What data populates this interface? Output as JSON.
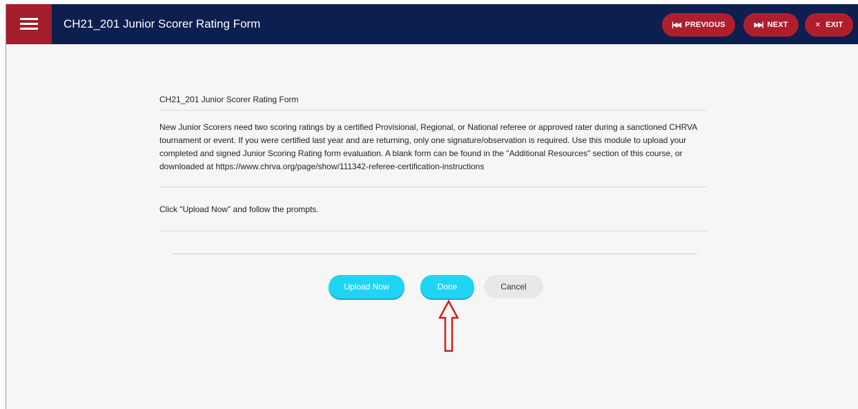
{
  "header": {
    "course_title": "CH21_201 Junior Scorer Rating Form",
    "previous_label": "PREVIOUS",
    "next_label": "NEXT",
    "exit_label": "EXIT"
  },
  "main": {
    "page_heading": "CH21_201 Junior Scorer Rating Form",
    "description": "New Junior Scorers need two scoring ratings by a certified Provisional, Regional, or National referee or approved rater during a sanctioned CHRVA tournament or event. If you were certified last year and are returning, only one signature/observation is required. Use this module to upload your completed and signed Junior Scoring Rating form evaluation. A blank form can be found in the \"Additional Resources\" section of this course, or downloaded at https://www.chrva.org/page/show/111342-referee-certification-instructions",
    "instruction": "Click \"Upload Now\" and follow the prompts."
  },
  "actions": {
    "upload_label": "Upload Now",
    "done_label": "Done",
    "cancel_label": "Cancel"
  },
  "icons": {
    "menu": "hamburger-menu-icon",
    "previous": "skip-back-icon",
    "next": "skip-forward-icon",
    "exit": "close-icon",
    "annotation": "up-arrow-icon"
  },
  "colors": {
    "header_bg": "#0c1f4e",
    "accent_red": "#b01e2e",
    "primary_cyan": "#1fd5f3",
    "secondary_gray": "#e8e8e8",
    "annotation_red": "#d01c1c"
  }
}
